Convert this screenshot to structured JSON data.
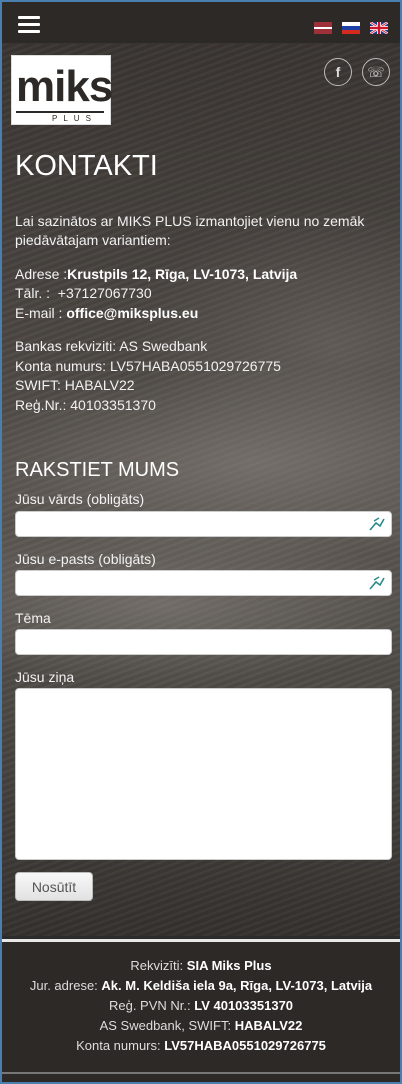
{
  "languages": [
    {
      "code": "lv",
      "name": "Latvian"
    },
    {
      "code": "ru",
      "name": "Russian"
    },
    {
      "code": "en",
      "name": "English"
    }
  ],
  "logo": {
    "brand": "miks",
    "sub": "PLUS"
  },
  "social": [
    {
      "icon": "facebook-icon",
      "glyph": "f"
    },
    {
      "icon": "draugiem-icon",
      "glyph": "☏"
    }
  ],
  "page": {
    "title": "KONTAKTI",
    "intro": "Lai sazinātos ar MIKS PLUS izmantojiet vienu no zemāk piedāvātajam variantiem:",
    "address_label": "Adrese :",
    "address_value": "Krustpils 12, Rīga, LV-1073, Latvija",
    "phone_label": "Tālr. :",
    "phone_value": "+37127067730",
    "email_label": "E-mail :",
    "email_value": "office@miksplus.eu",
    "bank_line": "Bankas rekviziti: AS Swedbank",
    "account_line": "Konta numurs: LV57HABA0551029726775",
    "swift_line": "SWIFT: HABALV22",
    "reg_line": "Reģ.Nr.: 40103351370"
  },
  "form": {
    "title": "RAKSTIET MUMS",
    "name_label": "Jūsu vārds (obligāts)",
    "email_label": "Jūsu e-pasts (obligāts)",
    "subject_label": "Tēma",
    "message_label": "Jūsu ziņa",
    "submit_label": "Nosūtīt"
  },
  "footer": {
    "rek_label": "Rekvizīti:",
    "rek_value": "SIA Miks Plus",
    "addr_label": "Jur. adrese:",
    "addr_value": "Ak. M. Keldiša iela 9a, Rīga, LV-1073, Latvija",
    "pvn_label": "Reģ. PVN Nr.:",
    "pvn_value": "LV 40103351370",
    "bank_label": "AS Swedbank, SWIFT:",
    "bank_value": "HABALV22",
    "acc_label": "Konta numurs:",
    "acc_value": "LV57HABA0551029726775"
  },
  "colors": {
    "topbar": "#2d2926",
    "footer": "#2d2926",
    "frame": "#4a7fb0"
  }
}
